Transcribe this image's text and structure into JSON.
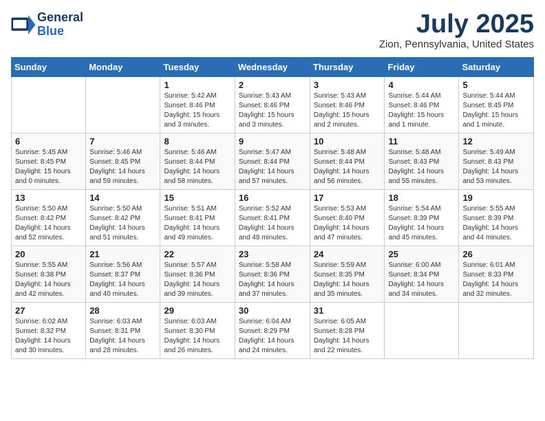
{
  "logo": {
    "line1": "General",
    "line2": "Blue"
  },
  "title": "July 2025",
  "location": "Zion, Pennsylvania, United States",
  "days_of_week": [
    "Sunday",
    "Monday",
    "Tuesday",
    "Wednesday",
    "Thursday",
    "Friday",
    "Saturday"
  ],
  "weeks": [
    [
      {
        "day": "",
        "sunrise": "",
        "sunset": "",
        "daylight": ""
      },
      {
        "day": "",
        "sunrise": "",
        "sunset": "",
        "daylight": ""
      },
      {
        "day": "1",
        "sunrise": "Sunrise: 5:42 AM",
        "sunset": "Sunset: 8:46 PM",
        "daylight": "Daylight: 15 hours and 3 minutes."
      },
      {
        "day": "2",
        "sunrise": "Sunrise: 5:43 AM",
        "sunset": "Sunset: 8:46 PM",
        "daylight": "Daylight: 15 hours and 3 minutes."
      },
      {
        "day": "3",
        "sunrise": "Sunrise: 5:43 AM",
        "sunset": "Sunset: 8:46 PM",
        "daylight": "Daylight: 15 hours and 2 minutes."
      },
      {
        "day": "4",
        "sunrise": "Sunrise: 5:44 AM",
        "sunset": "Sunset: 8:46 PM",
        "daylight": "Daylight: 15 hours and 1 minute."
      },
      {
        "day": "5",
        "sunrise": "Sunrise: 5:44 AM",
        "sunset": "Sunset: 8:45 PM",
        "daylight": "Daylight: 15 hours and 1 minute."
      }
    ],
    [
      {
        "day": "6",
        "sunrise": "Sunrise: 5:45 AM",
        "sunset": "Sunset: 8:45 PM",
        "daylight": "Daylight: 15 hours and 0 minutes."
      },
      {
        "day": "7",
        "sunrise": "Sunrise: 5:46 AM",
        "sunset": "Sunset: 8:45 PM",
        "daylight": "Daylight: 14 hours and 59 minutes."
      },
      {
        "day": "8",
        "sunrise": "Sunrise: 5:46 AM",
        "sunset": "Sunset: 8:44 PM",
        "daylight": "Daylight: 14 hours and 58 minutes."
      },
      {
        "day": "9",
        "sunrise": "Sunrise: 5:47 AM",
        "sunset": "Sunset: 8:44 PM",
        "daylight": "Daylight: 14 hours and 57 minutes."
      },
      {
        "day": "10",
        "sunrise": "Sunrise: 5:48 AM",
        "sunset": "Sunset: 8:44 PM",
        "daylight": "Daylight: 14 hours and 56 minutes."
      },
      {
        "day": "11",
        "sunrise": "Sunrise: 5:48 AM",
        "sunset": "Sunset: 8:43 PM",
        "daylight": "Daylight: 14 hours and 55 minutes."
      },
      {
        "day": "12",
        "sunrise": "Sunrise: 5:49 AM",
        "sunset": "Sunset: 8:43 PM",
        "daylight": "Daylight: 14 hours and 53 minutes."
      }
    ],
    [
      {
        "day": "13",
        "sunrise": "Sunrise: 5:50 AM",
        "sunset": "Sunset: 8:42 PM",
        "daylight": "Daylight: 14 hours and 52 minutes."
      },
      {
        "day": "14",
        "sunrise": "Sunrise: 5:50 AM",
        "sunset": "Sunset: 8:42 PM",
        "daylight": "Daylight: 14 hours and 51 minutes."
      },
      {
        "day": "15",
        "sunrise": "Sunrise: 5:51 AM",
        "sunset": "Sunset: 8:41 PM",
        "daylight": "Daylight: 14 hours and 49 minutes."
      },
      {
        "day": "16",
        "sunrise": "Sunrise: 5:52 AM",
        "sunset": "Sunset: 8:41 PM",
        "daylight": "Daylight: 14 hours and 48 minutes."
      },
      {
        "day": "17",
        "sunrise": "Sunrise: 5:53 AM",
        "sunset": "Sunset: 8:40 PM",
        "daylight": "Daylight: 14 hours and 47 minutes."
      },
      {
        "day": "18",
        "sunrise": "Sunrise: 5:54 AM",
        "sunset": "Sunset: 8:39 PM",
        "daylight": "Daylight: 14 hours and 45 minutes."
      },
      {
        "day": "19",
        "sunrise": "Sunrise: 5:55 AM",
        "sunset": "Sunset: 8:39 PM",
        "daylight": "Daylight: 14 hours and 44 minutes."
      }
    ],
    [
      {
        "day": "20",
        "sunrise": "Sunrise: 5:55 AM",
        "sunset": "Sunset: 8:38 PM",
        "daylight": "Daylight: 14 hours and 42 minutes."
      },
      {
        "day": "21",
        "sunrise": "Sunrise: 5:56 AM",
        "sunset": "Sunset: 8:37 PM",
        "daylight": "Daylight: 14 hours and 40 minutes."
      },
      {
        "day": "22",
        "sunrise": "Sunrise: 5:57 AM",
        "sunset": "Sunset: 8:36 PM",
        "daylight": "Daylight: 14 hours and 39 minutes."
      },
      {
        "day": "23",
        "sunrise": "Sunrise: 5:58 AM",
        "sunset": "Sunset: 8:36 PM",
        "daylight": "Daylight: 14 hours and 37 minutes."
      },
      {
        "day": "24",
        "sunrise": "Sunrise: 5:59 AM",
        "sunset": "Sunset: 8:35 PM",
        "daylight": "Daylight: 14 hours and 35 minutes."
      },
      {
        "day": "25",
        "sunrise": "Sunrise: 6:00 AM",
        "sunset": "Sunset: 8:34 PM",
        "daylight": "Daylight: 14 hours and 34 minutes."
      },
      {
        "day": "26",
        "sunrise": "Sunrise: 6:01 AM",
        "sunset": "Sunset: 8:33 PM",
        "daylight": "Daylight: 14 hours and 32 minutes."
      }
    ],
    [
      {
        "day": "27",
        "sunrise": "Sunrise: 6:02 AM",
        "sunset": "Sunset: 8:32 PM",
        "daylight": "Daylight: 14 hours and 30 minutes."
      },
      {
        "day": "28",
        "sunrise": "Sunrise: 6:03 AM",
        "sunset": "Sunset: 8:31 PM",
        "daylight": "Daylight: 14 hours and 28 minutes."
      },
      {
        "day": "29",
        "sunrise": "Sunrise: 6:03 AM",
        "sunset": "Sunset: 8:30 PM",
        "daylight": "Daylight: 14 hours and 26 minutes."
      },
      {
        "day": "30",
        "sunrise": "Sunrise: 6:04 AM",
        "sunset": "Sunset: 8:29 PM",
        "daylight": "Daylight: 14 hours and 24 minutes."
      },
      {
        "day": "31",
        "sunrise": "Sunrise: 6:05 AM",
        "sunset": "Sunset: 8:28 PM",
        "daylight": "Daylight: 14 hours and 22 minutes."
      },
      {
        "day": "",
        "sunrise": "",
        "sunset": "",
        "daylight": ""
      },
      {
        "day": "",
        "sunrise": "",
        "sunset": "",
        "daylight": ""
      }
    ]
  ]
}
